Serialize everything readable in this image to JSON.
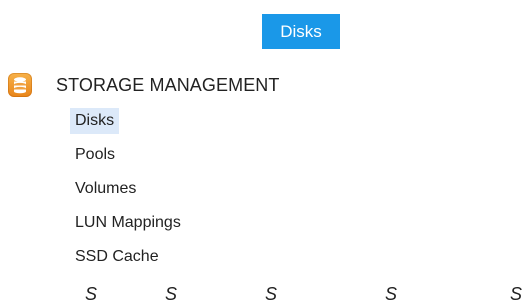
{
  "tooltip": {
    "text": "Disks",
    "color": "#1a98e8"
  },
  "section": {
    "title": "STORAGE MANAGEMENT",
    "icon": "storage-database-icon",
    "icon_color": "#f39a2b"
  },
  "nav": {
    "selected_bg": "#dce9f9",
    "items": [
      {
        "label": "Disks",
        "selected": true
      },
      {
        "label": "Pools",
        "selected": false
      },
      {
        "label": "Volumes",
        "selected": false
      },
      {
        "label": "LUN Mappings",
        "selected": false
      },
      {
        "label": "SSD Cache",
        "selected": false
      }
    ]
  },
  "columns": {
    "labels": [
      "S",
      "S",
      "S",
      "S",
      "S"
    ]
  }
}
